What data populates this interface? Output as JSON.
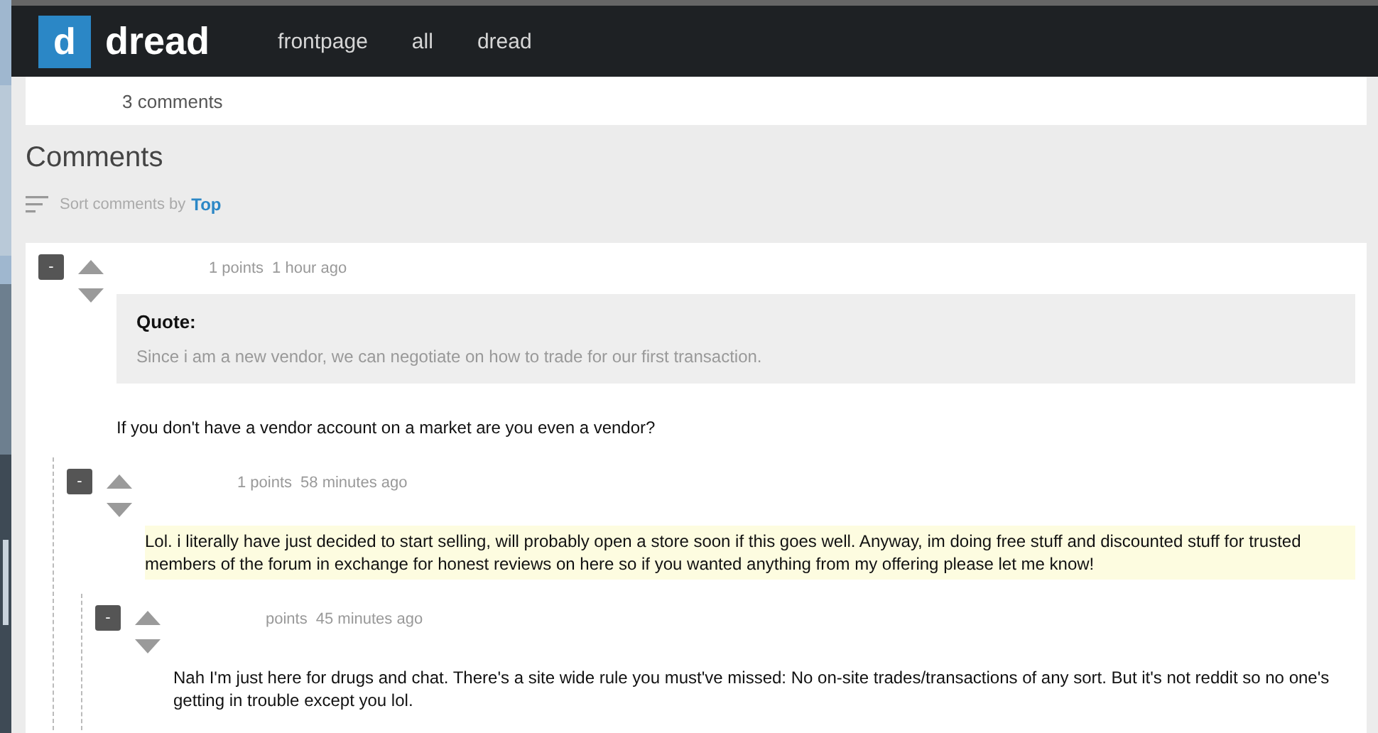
{
  "header": {
    "logo_letter": "d",
    "site_name": "dread",
    "nav": [
      "frontpage",
      "all",
      "dread"
    ]
  },
  "post": {
    "comment_count": "3 comments"
  },
  "comments_section": {
    "title": "Comments",
    "sort_label": "Sort comments by",
    "sort_value": "Top",
    "comments": [
      {
        "collapse": "-",
        "points": "1 points",
        "time": "1 hour ago",
        "highlighted": false,
        "quote": {
          "label": "Quote:",
          "text": "Since i am a new vendor, we can negotiate on how to trade for our first transaction."
        },
        "body": "If you don't have a vendor account on a market are you even a vendor?",
        "children": [
          {
            "collapse": "-",
            "points": "1 points",
            "time": "58 minutes ago",
            "highlighted": true,
            "body": "Lol. i literally have just decided to start selling, will probably open a store soon if this goes well. Anyway, im doing free stuff and discounted stuff for trusted members of the forum in exchange for honest reviews on here so if you wanted anything from my offering please let me know!",
            "children": [
              {
                "collapse": "-",
                "points": "points",
                "time": "45 minutes ago",
                "highlighted": false,
                "body": "Nah I'm just here for drugs and chat. There's a site wide rule you must've missed: No on-site trades/transactions of any sort. But it's not reddit so no one's getting in trouble except you lol."
              }
            ]
          }
        ]
      }
    ]
  }
}
